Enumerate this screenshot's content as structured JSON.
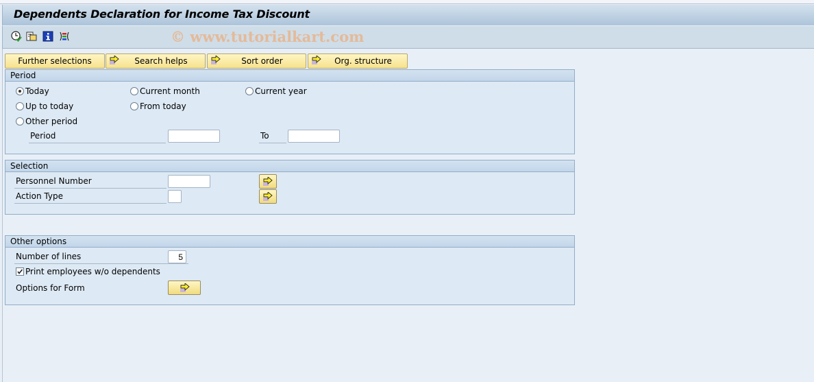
{
  "window": {
    "title": "Dependents Declaration for Income Tax Discount",
    "watermark": "© www.tutorialkart.com"
  },
  "toolbar": {
    "icons": [
      "execute-icon",
      "get-variant-icon",
      "program-info-icon",
      "selection-options-icon"
    ]
  },
  "tab_buttons": [
    {
      "label": "Further selections",
      "has_arrow": false
    },
    {
      "label": "Search helps",
      "has_arrow": true
    },
    {
      "label": "Sort order",
      "has_arrow": true
    },
    {
      "label": "Org. structure",
      "has_arrow": true
    }
  ],
  "period": {
    "title": "Period",
    "options": [
      {
        "label": "Today",
        "selected": true
      },
      {
        "label": "Current month",
        "selected": false
      },
      {
        "label": "Current year",
        "selected": false
      },
      {
        "label": "Up to today",
        "selected": false
      },
      {
        "label": "From today",
        "selected": false
      },
      {
        "label": "Other period",
        "selected": false
      }
    ],
    "period_label": "Period",
    "period_from": "",
    "to_label": "To",
    "period_to": ""
  },
  "selection": {
    "title": "Selection",
    "personnel_number_label": "Personnel Number",
    "personnel_number": "",
    "action_type_label": "Action Type",
    "action_type": ""
  },
  "other_options": {
    "title": "Other options",
    "number_of_lines_label": "Number of lines",
    "number_of_lines": "5",
    "print_without_dependents_label": "Print employees w/o dependents",
    "print_without_dependents": true,
    "options_for_form_label": "Options for Form"
  }
}
